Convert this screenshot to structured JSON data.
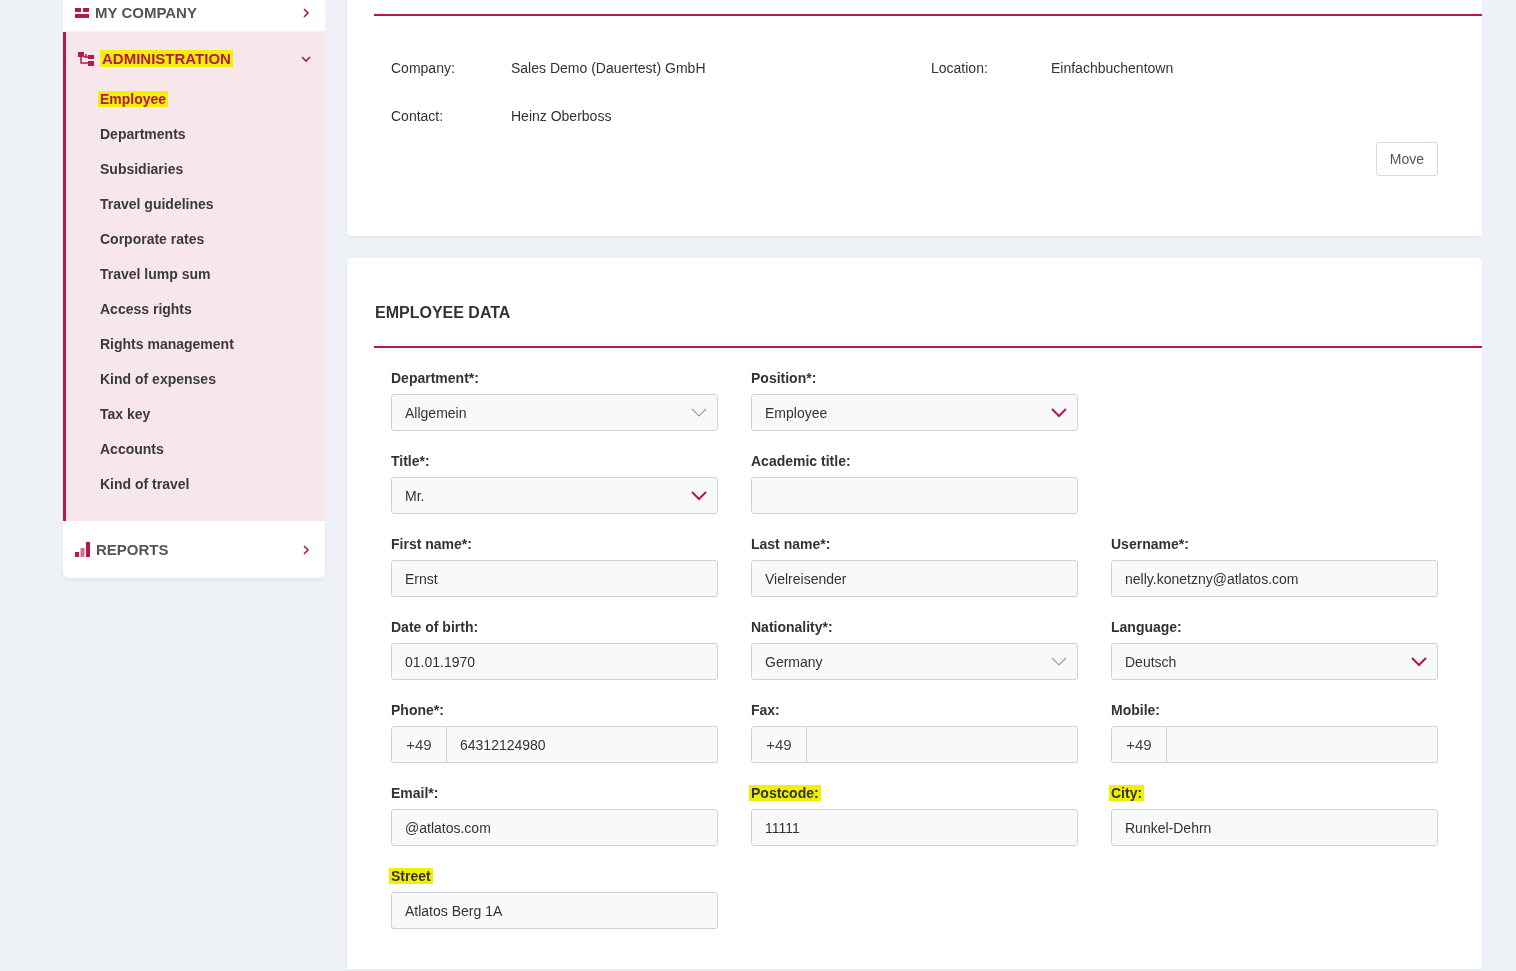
{
  "sidebar": {
    "sections": [
      {
        "title": "MY COMPANY",
        "expanded": false,
        "highlighted": false
      },
      {
        "title": "ADMINISTRATION",
        "expanded": true,
        "highlighted": true,
        "items": [
          {
            "label": "Employee",
            "selected": true,
            "highlighted": true
          },
          {
            "label": "Departments",
            "selected": false,
            "highlighted": false
          },
          {
            "label": "Subsidiaries",
            "selected": false,
            "highlighted": false
          },
          {
            "label": "Travel guidelines",
            "selected": false,
            "highlighted": false
          },
          {
            "label": "Corporate rates",
            "selected": false,
            "highlighted": false
          },
          {
            "label": "Travel lump sum",
            "selected": false,
            "highlighted": false
          },
          {
            "label": "Access rights",
            "selected": false,
            "highlighted": false
          },
          {
            "label": "Rights management",
            "selected": false,
            "highlighted": false
          },
          {
            "label": "Kind of expenses",
            "selected": false,
            "highlighted": false
          },
          {
            "label": "Tax key",
            "selected": false,
            "highlighted": false
          },
          {
            "label": "Accounts",
            "selected": false,
            "highlighted": false
          },
          {
            "label": "Kind of travel",
            "selected": false,
            "highlighted": false
          }
        ]
      },
      {
        "title": "REPORTS",
        "expanded": false,
        "highlighted": false
      }
    ]
  },
  "company_card": {
    "rows": [
      [
        {
          "label": "Company:",
          "value": "Sales Demo (Dauertest) GmbH"
        },
        {
          "label": "Location:",
          "value": "Einfachbuchentown"
        }
      ],
      [
        {
          "label": "Contact:",
          "value": "Heinz Oberboss"
        }
      ]
    ],
    "button": "Move"
  },
  "employee_data": {
    "title": "EMPLOYEE DATA",
    "rows": [
      [
        {
          "label": "Department*:",
          "kind": "select",
          "value": "Allgemein",
          "disabled": true,
          "highlighted": false
        },
        {
          "label": "Position*:",
          "kind": "select",
          "value": "Employee",
          "disabled": false,
          "highlighted": false
        }
      ],
      [
        {
          "label": "Title*:",
          "kind": "select",
          "value": "Mr.",
          "disabled": false,
          "highlighted": false
        },
        {
          "label": "Academic title:",
          "kind": "text",
          "highlighted": false
        }
      ],
      [
        {
          "label": "First name*:",
          "kind": "text",
          "value": "Ernst",
          "highlighted": false
        },
        {
          "label": "Last name*:",
          "kind": "text",
          "value": "Vielreisender",
          "highlighted": false
        },
        {
          "label": "Username*:",
          "kind": "text",
          "value": "nelly.konetzny@atlatos.com",
          "highlighted": false
        }
      ],
      [
        {
          "label": "Date of birth:",
          "kind": "text",
          "value": "01.01.1970",
          "highlighted": false
        },
        {
          "label": "Nationality*:",
          "kind": "select",
          "value": "Germany",
          "disabled": true,
          "highlighted": false
        },
        {
          "label": "Language:",
          "kind": "select",
          "value": "Deutsch",
          "disabled": false,
          "highlighted": false
        }
      ],
      [
        {
          "label": "Phone*:",
          "kind": "phone",
          "prefix": "+49",
          "value": "64312124980",
          "highlighted": false
        },
        {
          "label": "Fax:",
          "kind": "phone",
          "prefix": "+49",
          "highlighted": false
        },
        {
          "label": "Mobile:",
          "kind": "phone",
          "prefix": "+49",
          "highlighted": false
        }
      ],
      [
        {
          "label": "Email*:",
          "kind": "text",
          "value": "@atlatos.com",
          "highlighted": false
        },
        {
          "label": "Postcode:",
          "kind": "text",
          "value": "11111",
          "highlighted": true
        },
        {
          "label": "City:",
          "kind": "text",
          "value": "Runkel-Dehrn",
          "highlighted": true
        }
      ],
      [
        {
          "label": "Street",
          "kind": "text",
          "value": "Atlatos Berg 1A",
          "highlighted": true
        }
      ]
    ]
  }
}
